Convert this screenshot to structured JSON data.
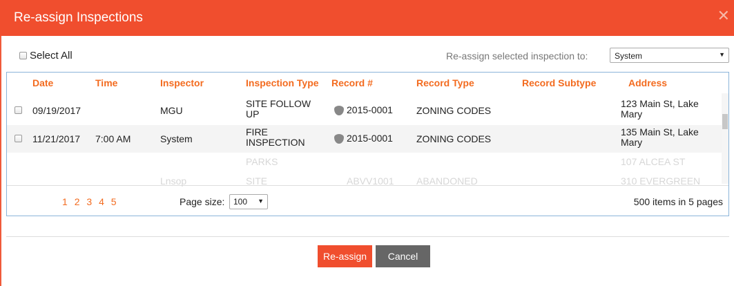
{
  "dialog": {
    "title": "Re-assign Inspections",
    "close_icon": "close-icon"
  },
  "toolbar": {
    "select_all_label": "Select All",
    "reassign_label": "Re-assign selected inspection to:",
    "assignee_selected": "System"
  },
  "grid": {
    "columns": [
      "Date",
      "Time",
      "Inspector",
      "Inspection Type",
      "Record #",
      "Record Type",
      "Record Subtype",
      "Address"
    ],
    "rows": [
      {
        "date": "09/19/2017",
        "time": "",
        "inspector": "MGU",
        "type_line1": "SITE FOLLOW",
        "type_line2": "UP",
        "record": "2015-0001",
        "record_type": "ZONING CODES",
        "subtype": "",
        "addr1": "123 Main St, Lake",
        "addr2": "Mary"
      },
      {
        "date": "11/21/2017",
        "time": "7:00 AM",
        "inspector": "System",
        "type_line1": "FIRE",
        "type_line2": "INSPECTION",
        "record": "2015-0001",
        "record_type": "ZONING CODES",
        "subtype": "",
        "addr1": "135 Main St, Lake",
        "addr2": "Mary"
      }
    ],
    "faded": {
      "r1_type": "PARKS",
      "r1_addr": "107 ALCEA ST",
      "r2_inspector": "Lnsop",
      "r2_type": "SITE",
      "r2_record": "ABVV1001",
      "r2_record_type": "ABANDONED",
      "r2_addr": "310 EVERGREEN"
    }
  },
  "pager": {
    "pages": [
      "1",
      "2",
      "3",
      "4",
      "5"
    ],
    "page_size_label": "Page size:",
    "page_size": "100",
    "summary": "500 items in 5 pages"
  },
  "actions": {
    "reassign": "Re-assign",
    "cancel": "Cancel"
  },
  "colors": {
    "accent": "#f04e2e",
    "header_text": "#f36b1f",
    "cancel": "#666666"
  }
}
